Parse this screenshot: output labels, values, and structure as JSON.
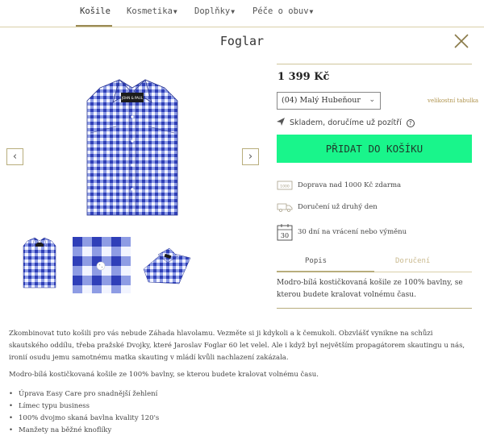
{
  "nav": {
    "items": [
      {
        "label": "Košile"
      },
      {
        "label": "Kosmetika"
      },
      {
        "label": "Doplňky"
      },
      {
        "label": "Péče o obuv"
      }
    ]
  },
  "product": {
    "title": "Foglar",
    "price": "1 399 Kč",
    "size_selected": "(04) Malý Hubeňour",
    "size_table_label": "velikostní tabulka",
    "stock_text": "Skladem, doručíme už pozítří",
    "add_to_cart": "PŘIDAT DO KOŠÍKU",
    "shirt_brand": "JOHN & PAUL"
  },
  "features": [
    {
      "icon": "truck-1000-icon",
      "text": "Doprava nad 1000 Kč zdarma"
    },
    {
      "icon": "delivery-van-icon",
      "text": "Doručení už druhý den"
    },
    {
      "icon": "calendar-30-icon",
      "text": "30 dní na vrácení nebo výměnu",
      "badge": "30"
    }
  ],
  "tabs": [
    {
      "label": "Popis"
    },
    {
      "label": "Doručení"
    }
  ],
  "tab_content": "Modro-bílá kostičkovaná košile ze 100% bavlny, se kterou budete kralovat volnému času.",
  "description": {
    "paragraph": "Zkombinovat tuto košili pro vás nebude Záhada hlavolamu. Vezměte si ji kdykoli a k čemukoli. Obzvlášť vynikne na schůzi skautského oddílu, třeba pražské Dvojky, které Jaroslav Foglar 60 let velel. Ale i když byl největším propagátorem skautingu u nás, ironií osudu jemu samotnému matka skauting v mládí kvůli nachlazení zakázala.",
    "line2": "Modro-bílá kostičkovaná košile ze 100% bavlny, se kterou budete kralovat volnému času.",
    "bullets": [
      "Úprava Easy Care pro snadnější žehlení",
      "Límec typu business",
      "100% dvojmo skaná bavlna kvality 120's",
      "Manžety na běžné knoflíky"
    ]
  },
  "colors": {
    "accent_gold": "#9a8a55",
    "cart_green": "#19f58b",
    "shirt_blue": "#3b4fc4"
  }
}
